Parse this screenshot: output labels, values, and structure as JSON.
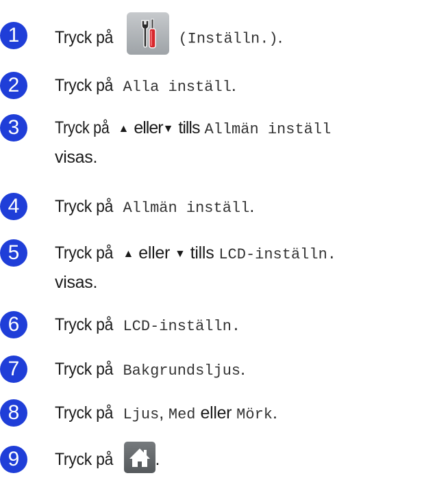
{
  "steps": [
    {
      "number": "1",
      "parts": {
        "prefix": "Tryck på",
        "button_label": "(Inställn.)",
        "suffix": "."
      }
    },
    {
      "number": "2",
      "parts": {
        "prefix": "Tryck på",
        "button_label": "Alla inställ",
        "suffix": "."
      }
    },
    {
      "number": "3",
      "parts": {
        "prefix": "Tryck på",
        "up_arrow": "▲",
        "or": "eller",
        "down_arrow": "▼",
        "until": "tills",
        "button_label": "Allmän inställ",
        "line2": "visas."
      }
    },
    {
      "number": "4",
      "parts": {
        "prefix": "Tryck på",
        "button_label": "Allmän inställ",
        "suffix": "."
      }
    },
    {
      "number": "5",
      "parts": {
        "prefix": "Tryck på",
        "up_arrow": "▲",
        "or": "eller",
        "down_arrow": "▼",
        "until": "tills",
        "button_label": "LCD-inställn.",
        "line2": "visas."
      }
    },
    {
      "number": "6",
      "parts": {
        "prefix": "Tryck på",
        "button_label": "LCD-inställn.",
        "suffix": ""
      }
    },
    {
      "number": "7",
      "parts": {
        "prefix": "Tryck på",
        "button_label": "Bakgrundsljus",
        "suffix": "."
      }
    },
    {
      "number": "8",
      "parts": {
        "prefix": "Tryck på",
        "option_1": "Ljus",
        "separator": ",",
        "option_2": "Med",
        "or": "eller",
        "option_3": "Mörk",
        "suffix": "."
      }
    },
    {
      "number": "9",
      "parts": {
        "prefix": "Tryck på",
        "suffix": "."
      }
    }
  ],
  "icons": {
    "settings": "settings-tools-icon",
    "home": "home-icon"
  },
  "colors": {
    "badge": "#1f3ed8",
    "text": "#1a1a1a",
    "background": "#ffffff"
  }
}
